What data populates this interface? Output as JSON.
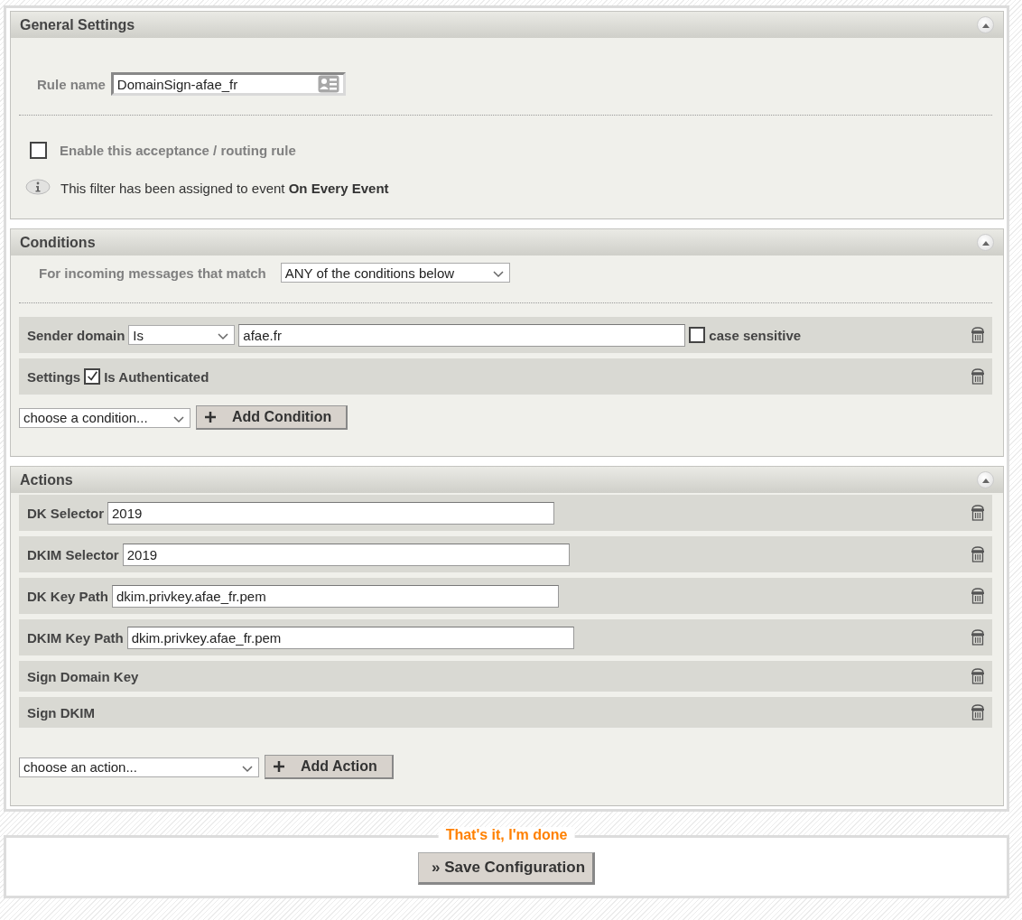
{
  "general": {
    "title": "General Settings",
    "expanded": true,
    "rule_name_label": "Rule name",
    "rule_name_value": "DomainSign-afae_fr",
    "enable": {
      "label": "Enable this acceptance / routing rule",
      "checked": false
    },
    "info": "This filter has been assigned to event **On Every Event**"
  },
  "conditions": {
    "title": "Conditions",
    "expanded": true,
    "match_label": "For incoming messages that match",
    "match_value": "ANY of the conditions below",
    "rows": [
      {
        "kind": "select_input",
        "label": "Sender domain",
        "operator": "Is",
        "value": "afae.fr",
        "option_label": "case sensitive",
        "checked": false
      },
      {
        "kind": "checkbox",
        "label": "Settings",
        "option_label": "Is Authenticated",
        "checked": true
      }
    ],
    "add_select": "choose a condition...",
    "add_button": "Add Condition"
  },
  "actions": {
    "title": "Actions",
    "expanded": true,
    "rows": [
      {
        "kind": "input",
        "label": "DK Selector",
        "value": "2019"
      },
      {
        "kind": "input",
        "label": "DKIM Selector",
        "value": "2019"
      },
      {
        "kind": "input",
        "label": "DK Key Path",
        "value": "dkim.privkey.afae_fr.pem"
      },
      {
        "kind": "input",
        "label": "DKIM Key Path",
        "value": "dkim.privkey.afae_fr.pem"
      },
      {
        "kind": "plain",
        "label": "Sign Domain Key"
      },
      {
        "kind": "plain",
        "label": "Sign DKIM"
      }
    ],
    "add_select": "choose an action...",
    "add_button": "Add Action"
  },
  "footer": {
    "legend": "That's it, I'm done",
    "button": "» Save Configuration"
  }
}
